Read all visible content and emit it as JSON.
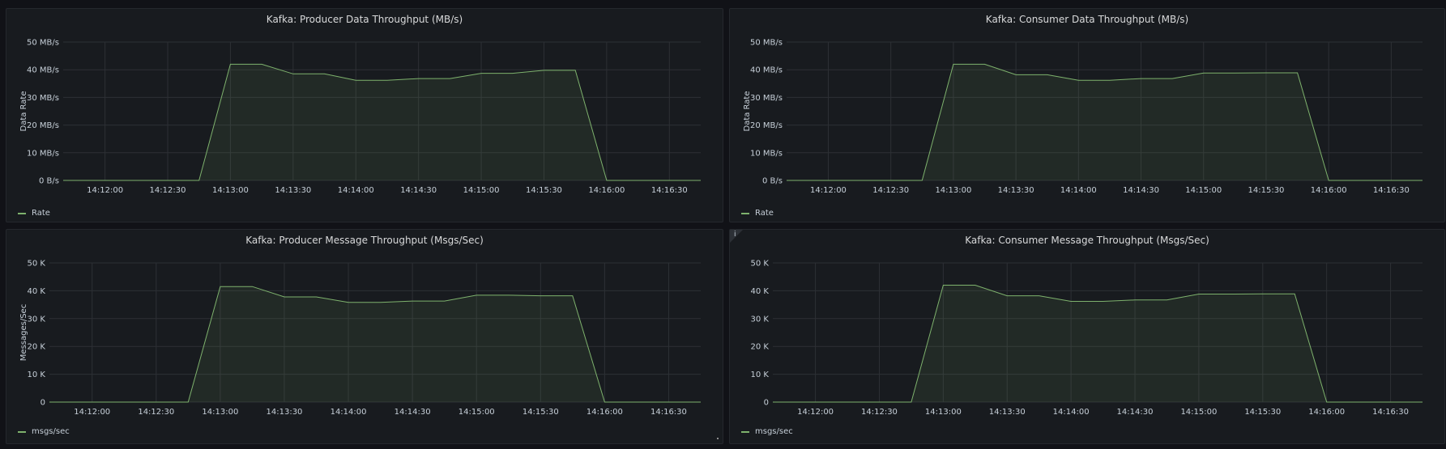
{
  "theme": {
    "series_color": "#7eb26d",
    "fill_color": "rgba(126,178,109,0.10)",
    "grid_color": "#2d3035",
    "axis_text_color": "#c7d0d9",
    "title_color": "#d8d9da",
    "panel_bg": "#181b1f",
    "page_bg": "#111217"
  },
  "time_ticks": [
    "14:12:00",
    "14:12:30",
    "14:13:00",
    "14:13:30",
    "14:14:00",
    "14:14:30",
    "14:15:00",
    "14:15:30",
    "14:16:00",
    "14:16:30"
  ],
  "panels": [
    {
      "title": "Kafka: Producer Data Throughput (MB/s)",
      "ylabel": "Data Rate",
      "legend": "Rate",
      "info_icon": false
    },
    {
      "title": "Kafka: Consumer Data Throughput (MB/s)",
      "ylabel": "Data Rate",
      "legend": "Rate",
      "info_icon": false
    },
    {
      "title": "Kafka: Producer Message Throughput (Msgs/Sec)",
      "ylabel": "Messages/Sec",
      "legend": "msgs/sec",
      "info_icon": false
    },
    {
      "title": "Kafka: Consumer Message Throughput (Msgs/Sec)",
      "ylabel": "",
      "legend": "msgs/sec",
      "info_icon": true,
      "info_glyph": "i"
    }
  ],
  "chart_data": [
    {
      "type": "area",
      "title": "Kafka: Producer Data Throughput (MB/s)",
      "ylabel": "Data Rate",
      "xlabel": "",
      "yticks": [
        "0 B/s",
        "10 MB/s",
        "20 MB/s",
        "30 MB/s",
        "40 MB/s",
        "50 MB/s"
      ],
      "ylim": [
        0,
        50
      ],
      "grid": true,
      "legend": "bottom-left",
      "x": [
        "14:11:40",
        "14:12:45",
        "14:13:00",
        "14:13:15",
        "14:13:30",
        "14:13:45",
        "14:14:00",
        "14:14:15",
        "14:14:30",
        "14:14:45",
        "14:15:00",
        "14:15:15",
        "14:15:30",
        "14:15:45",
        "14:16:00",
        "14:16:45"
      ],
      "series": [
        {
          "name": "Rate",
          "values": [
            0,
            0,
            42,
            42,
            38.5,
            38.5,
            36.2,
            36.2,
            36.8,
            36.8,
            38.7,
            38.7,
            39.8,
            39.8,
            0,
            0
          ]
        }
      ]
    },
    {
      "type": "area",
      "title": "Kafka: Consumer Data Throughput (MB/s)",
      "ylabel": "Data Rate",
      "xlabel": "",
      "yticks": [
        "0 B/s",
        "10 MB/s",
        "20 MB/s",
        "30 MB/s",
        "40 MB/s",
        "50 MB/s"
      ],
      "ylim": [
        0,
        50
      ],
      "grid": true,
      "legend": "bottom-left",
      "x": [
        "14:11:40",
        "14:12:45",
        "14:13:00",
        "14:13:15",
        "14:13:30",
        "14:13:45",
        "14:14:00",
        "14:14:15",
        "14:14:30",
        "14:14:45",
        "14:15:00",
        "14:15:15",
        "14:15:30",
        "14:15:45",
        "14:16:00",
        "14:16:45"
      ],
      "series": [
        {
          "name": "Rate",
          "values": [
            0,
            0,
            42,
            42,
            38.2,
            38.2,
            36.2,
            36.2,
            36.8,
            36.8,
            38.8,
            38.8,
            38.9,
            38.9,
            0,
            0
          ]
        }
      ]
    },
    {
      "type": "area",
      "title": "Kafka: Producer Message Throughput (Msgs/Sec)",
      "ylabel": "Messages/Sec",
      "xlabel": "",
      "yticks": [
        "0",
        "10 K",
        "20 K",
        "30 K",
        "40 K",
        "50 K"
      ],
      "ylim": [
        0,
        50000
      ],
      "grid": true,
      "legend": "bottom-left",
      "x": [
        "14:11:40",
        "14:12:45",
        "14:13:00",
        "14:13:15",
        "14:13:30",
        "14:13:45",
        "14:14:00",
        "14:14:15",
        "14:14:30",
        "14:14:45",
        "14:15:00",
        "14:15:15",
        "14:15:30",
        "14:15:45",
        "14:16:00",
        "14:16:45"
      ],
      "series": [
        {
          "name": "msgs/sec",
          "values": [
            0,
            0,
            41500,
            41500,
            37800,
            37800,
            35800,
            35800,
            36300,
            36300,
            38400,
            38400,
            38200,
            38200,
            0,
            0
          ]
        }
      ]
    },
    {
      "type": "area",
      "title": "Kafka: Consumer Message Throughput (Msgs/Sec)",
      "ylabel": "",
      "xlabel": "",
      "yticks": [
        "0",
        "10 K",
        "20 K",
        "30 K",
        "40 K",
        "50 K"
      ],
      "ylim": [
        0,
        50000
      ],
      "grid": true,
      "legend": "bottom-left",
      "x": [
        "14:11:40",
        "14:12:45",
        "14:13:00",
        "14:13:15",
        "14:13:30",
        "14:13:45",
        "14:14:00",
        "14:14:15",
        "14:14:30",
        "14:14:45",
        "14:15:00",
        "14:15:15",
        "14:15:30",
        "14:15:45",
        "14:16:00",
        "14:16:45"
      ],
      "series": [
        {
          "name": "msgs/sec",
          "values": [
            0,
            0,
            42000,
            42000,
            38200,
            38200,
            36200,
            36200,
            36700,
            36700,
            38800,
            38800,
            38900,
            38900,
            0,
            0
          ]
        }
      ]
    }
  ]
}
